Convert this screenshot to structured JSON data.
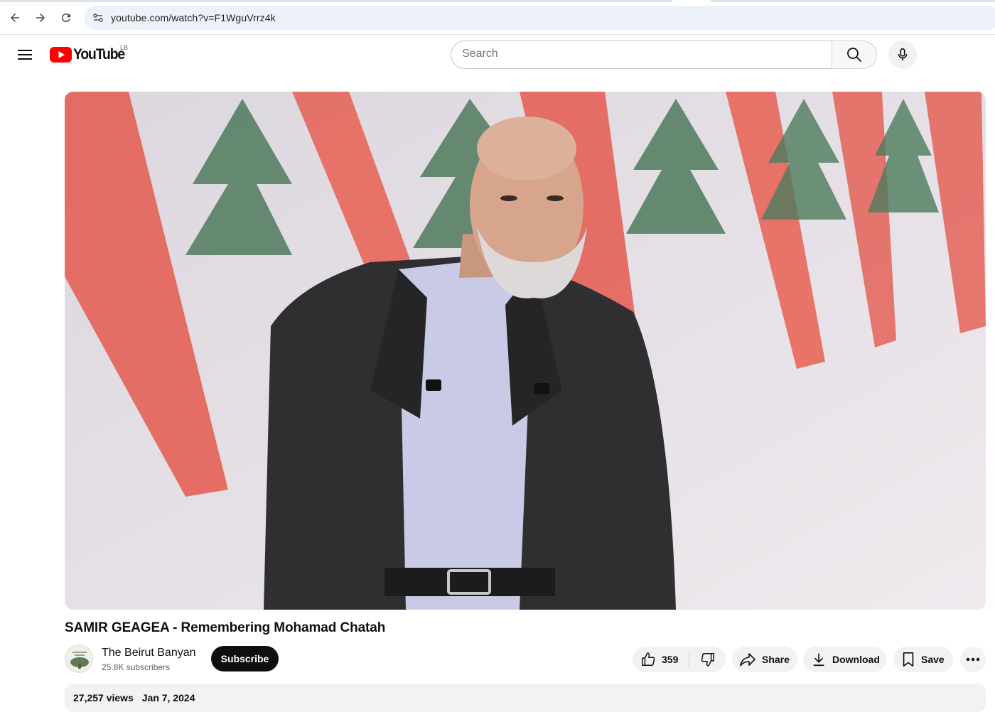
{
  "browser": {
    "url": "youtube.com/watch?v=F1WguVrrz4k"
  },
  "header": {
    "logo_text": "YouTube",
    "country_code": "LB",
    "search_placeholder": "Search"
  },
  "video": {
    "title": "SAMIR GEAGEA - Remembering Mohamad Chatah",
    "channel_name": "The Beirut Banyan",
    "subscribers": "25.8K subscribers",
    "subscribe_label": "Subscribe",
    "likes": "359",
    "share_label": "Share",
    "download_label": "Download",
    "save_label": "Save",
    "views": "27,257 views",
    "date": "Jan 7, 2024"
  },
  "colors": {
    "brand_red": "#ff0000",
    "text_primary": "#0f0f0f",
    "text_secondary": "#606060",
    "pill_bg": "#f2f2f2"
  },
  "icons": [
    "back-arrow-icon",
    "forward-arrow-icon",
    "reload-icon",
    "site-info-icon",
    "hamburger-menu-icon",
    "youtube-logo-icon",
    "search-icon",
    "microphone-icon",
    "thumbs-up-icon",
    "thumbs-down-icon",
    "share-arrow-icon",
    "download-icon",
    "bookmark-icon",
    "more-horizontal-icon"
  ]
}
